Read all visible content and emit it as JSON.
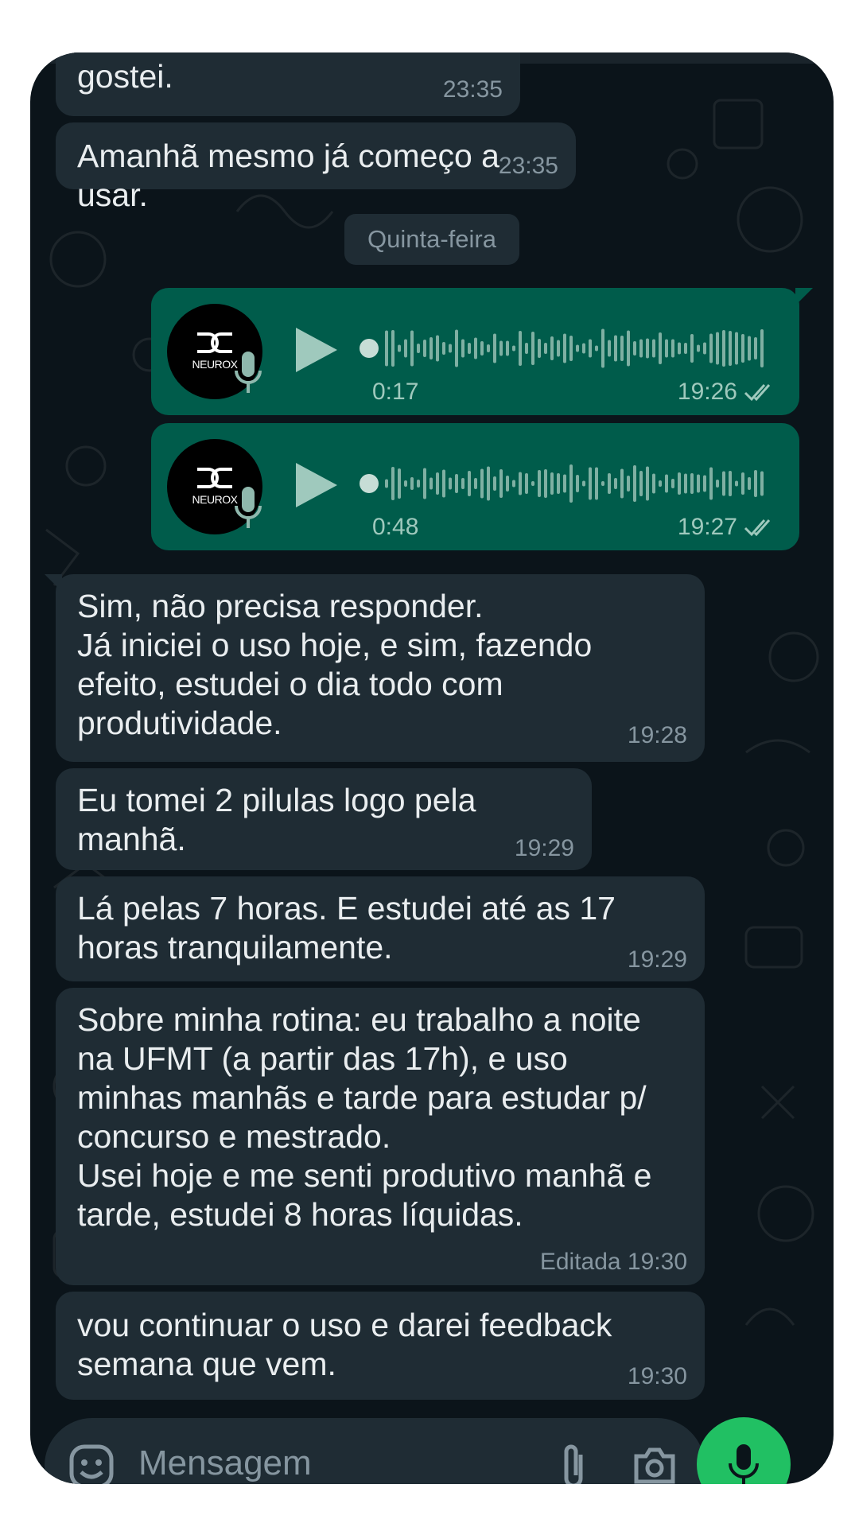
{
  "chat": {
    "messages": [
      {
        "text": "gostei.",
        "time": "23:35"
      },
      {
        "text": "Amanhã mesmo já começo a usar.",
        "time": "23:35"
      },
      {
        "text": "Sim, não precisa responder.\nJá iniciei o uso hoje, e sim, fazendo\nefeito, estudei o dia todo com\nprodutividade.",
        "time": "19:28"
      },
      {
        "text": "Eu tomei 2 pilulas logo pela manhã.",
        "time": "19:29"
      },
      {
        "text": "Lá pelas 7 horas. E estudei até as 17\nhoras tranquilamente.",
        "time": "19:29"
      },
      {
        "text": "Sobre minha rotina: eu trabalho a noite\nna UFMT (a partir das 17h), e uso\nminhas manhãs e tarde para estudar p/\nconcurso e mestrado.\nUsei hoje e me senti produtivo manhã e\ntarde, estudei 8 horas líquidas.",
        "time": "Editada 19:30"
      },
      {
        "text": "vou continuar o uso e darei feedback\nsemana que vem.",
        "time": "19:30"
      }
    ],
    "date_separator": "Quinta-feira",
    "voice_notes": [
      {
        "duration": "0:17",
        "time": "19:26",
        "avatar_text": "NEUROX"
      },
      {
        "duration": "0:48",
        "time": "19:27",
        "avatar_text": "NEUROX"
      }
    ]
  },
  "composer": {
    "placeholder": "Mensagem"
  },
  "colors": {
    "background": "#0b141a",
    "incoming_bubble": "#1f2c34",
    "outgoing_bubble": "#005c4b",
    "send_button": "#21c063"
  },
  "icons": [
    "play-icon",
    "mic-icon",
    "double-check-icon",
    "emoji-icon",
    "attach-icon",
    "camera-icon"
  ]
}
